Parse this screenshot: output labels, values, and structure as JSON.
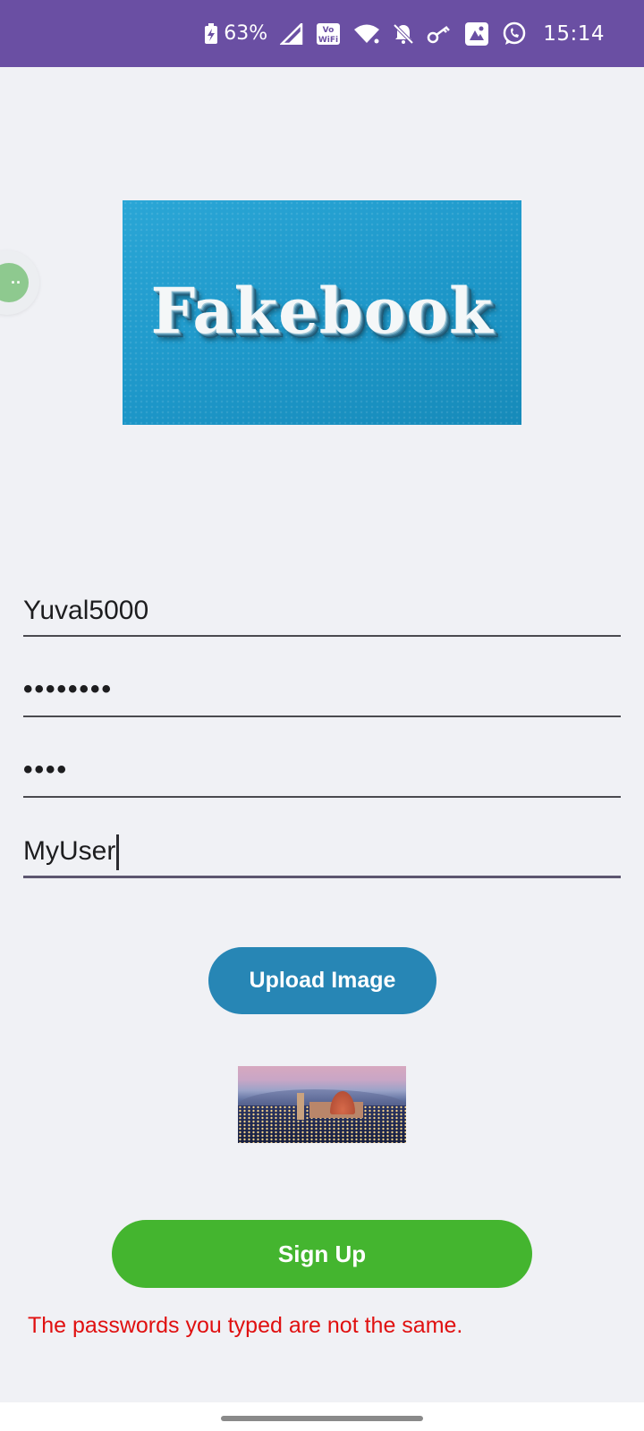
{
  "status_bar": {
    "battery_percent": "63%",
    "time": "15:14",
    "background_color": "#6a4fa3",
    "icons": [
      "battery-charging-icon",
      "signal-icon",
      "vowifi-icon",
      "wifi-icon",
      "notifications-off-icon",
      "key-icon",
      "gallery-icon",
      "whatsapp-icon"
    ]
  },
  "floating_bubble": {
    "glyph": "··"
  },
  "logo": {
    "text": "Fakebook"
  },
  "form": {
    "username": {
      "value": "Yuval5000"
    },
    "password": {
      "value": "••••••••"
    },
    "confirm_password": {
      "value": "••••"
    },
    "display_name": {
      "value": "MyUser"
    }
  },
  "buttons": {
    "upload_image": "Upload Image",
    "sign_up": "Sign Up",
    "upload_color": "#2786b5",
    "sign_up_color": "#44b52f"
  },
  "error": {
    "message": "The passwords you typed are not the same.",
    "color": "#e01010"
  }
}
